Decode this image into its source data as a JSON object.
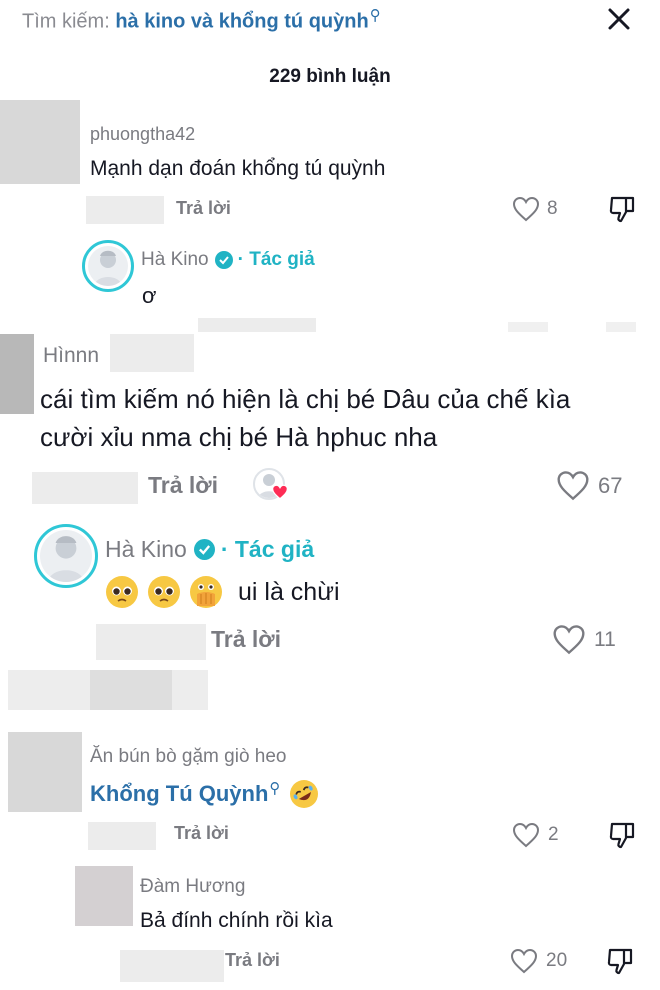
{
  "search": {
    "prefix": "Tìm kiếm:",
    "query": "hà kino và khổng tú quỳnh",
    "query_icon": "search-icon"
  },
  "comment_count": "229 bình luận",
  "colors": {
    "author_accent": "#20b3c4",
    "link_blue": "#2b6fa8",
    "gray_text": "#7a7b81",
    "heart_red": "#fe2c55"
  },
  "comments": [
    {
      "username": "phuongtha42",
      "text": "Mạnh dạn đoán khổng tú quỳnh",
      "reply_label": "Trả lời",
      "likes": "8",
      "reply": {
        "username": "Hà Kino",
        "badge": "· Tác giả",
        "text": "ơ"
      }
    },
    {
      "username": "Hìnnn",
      "text_line1": "cái tìm kiếm nó hiện là chị bé Dâu của chế kìa",
      "text_line2": "cười xỉu nma chị bé Hà hphuc nha",
      "reply_label": "Trả lời",
      "likes": "67",
      "reply": {
        "username": "Hà Kino",
        "badge": "· Tác giả",
        "text": "ui là chừi",
        "emojis": [
          "pleading-face-icon",
          "pleading-face-icon",
          "face-with-open-eyes-and-hand-over-mouth-icon"
        ],
        "reply_label": "Trả lời",
        "likes": "11"
      }
    },
    {
      "username": "Ăn bún bò gặm giò heo",
      "text": "Khổng Tú Quỳnh",
      "text_icon": "search-icon",
      "emoji": "rolling-on-floor-laughing-icon",
      "reply_label": "Trả lời",
      "likes": "2",
      "reply": {
        "username": "Đàm Hương",
        "text": "Bả đính chính rồi kìa",
        "reply_label": "Trả lời",
        "likes": "20"
      }
    }
  ]
}
